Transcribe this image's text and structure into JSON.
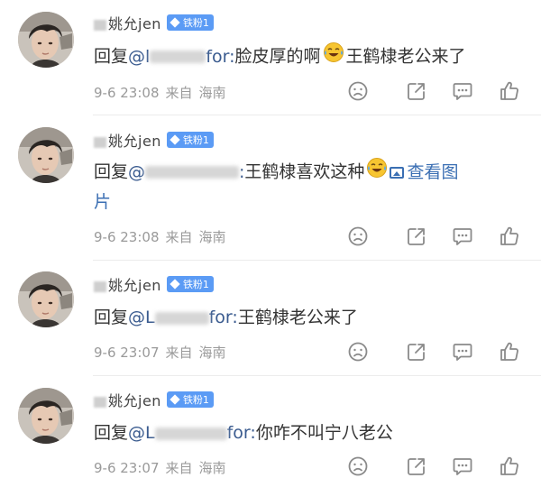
{
  "fan_badge": "铁粉1",
  "comments": [
    {
      "username": "姚允jen",
      "reply_prefix": "回复",
      "handle_start": "@l",
      "handle_end": "for:",
      "text_a": "脸皮厚的啊",
      "text_b": "王鹤棣老公来了",
      "date": "9-6 23:08",
      "from": "来自",
      "location": "海南"
    },
    {
      "username": "姚允jen",
      "reply_prefix": "回复",
      "handle_start": "@",
      "handle_end": ":",
      "text_a": "王鹤棣喜欢这种",
      "view_image": "查看图",
      "view_image_tail": "片",
      "date": "9-6 23:08",
      "from": "来自",
      "location": "海南"
    },
    {
      "username": "姚允jen",
      "reply_prefix": "回复",
      "handle_start": "@L",
      "handle_end": "for:",
      "text_a": "王鹤棣老公来了",
      "date": "9-6 23:07",
      "from": "来自",
      "location": "海南"
    },
    {
      "username": "姚允jen",
      "reply_prefix": "回复",
      "handle_start": "@L",
      "handle_end": "for:",
      "text_a": "你咋不叫宁八老公",
      "date": "9-6 23:07",
      "from": "来自",
      "location": "海南"
    }
  ],
  "icons": [
    "sad-face-icon",
    "share-icon",
    "comment-icon",
    "thumbs-up-icon",
    "laughing-crying-emoji-icon",
    "image-icon"
  ],
  "colors": {
    "badge": "#5b9bf5",
    "link": "#3b6fb3",
    "meta": "#9a9a9a"
  }
}
